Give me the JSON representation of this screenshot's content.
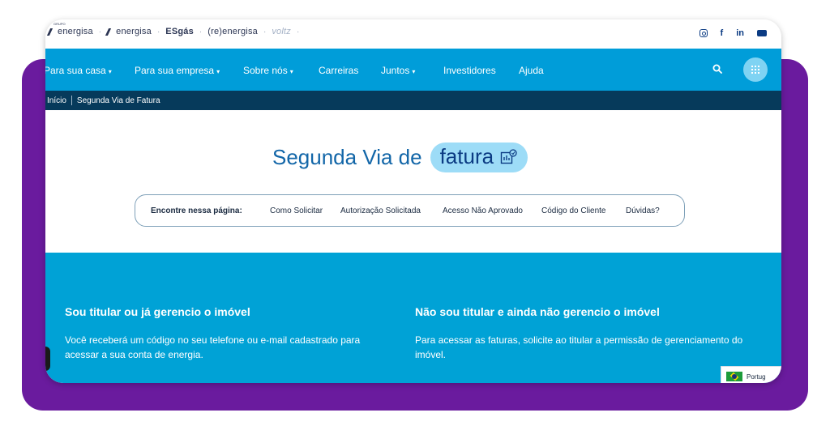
{
  "brands": {
    "items": [
      "energisa",
      "energisa",
      "ESgás",
      "(re)energisa",
      "voltz"
    ],
    "group_label": "GRUPO"
  },
  "social": {
    "facebook": "f",
    "linkedin": "in"
  },
  "nav": {
    "items": [
      {
        "label": "Para sua casa",
        "dropdown": true
      },
      {
        "label": "Para sua empresa",
        "dropdown": true
      },
      {
        "label": "Sobre nós",
        "dropdown": true
      },
      {
        "label": "Carreiras",
        "dropdown": false
      },
      {
        "label": "Juntos",
        "dropdown": true
      },
      {
        "label": "Investidores",
        "dropdown": false
      },
      {
        "label": "Ajuda",
        "dropdown": false
      }
    ]
  },
  "breadcrumb": {
    "home": "Início",
    "current": "Segunda Via de Fatura"
  },
  "hero": {
    "title": "Segunda Via de",
    "highlight": "fatura"
  },
  "finder": {
    "label": "Encontre nessa página:",
    "links": [
      "Como Solicitar",
      "Autorização Solicitada",
      "Acesso Não Aprovado",
      "Código do Cliente",
      "Dúvidas?"
    ]
  },
  "options": {
    "holder": {
      "title": "Sou titular ou já gerencio o imóvel",
      "text": "Você receberá um código no seu telefone ou e-mail cadastrado para acessar a sua conta de energia."
    },
    "non_holder": {
      "title": "Não sou titular e ainda não gerencio o imóvel",
      "text": "Para acessar as faturas, solicite ao titular a permissão de gerenciamento do imóvel."
    }
  },
  "language": {
    "label": "Portug"
  },
  "colors": {
    "accent_blue": "#009dd9",
    "dark_navy": "#063a5b",
    "purple_back": "#6a1b9e",
    "pill": "#9ddcf7"
  }
}
